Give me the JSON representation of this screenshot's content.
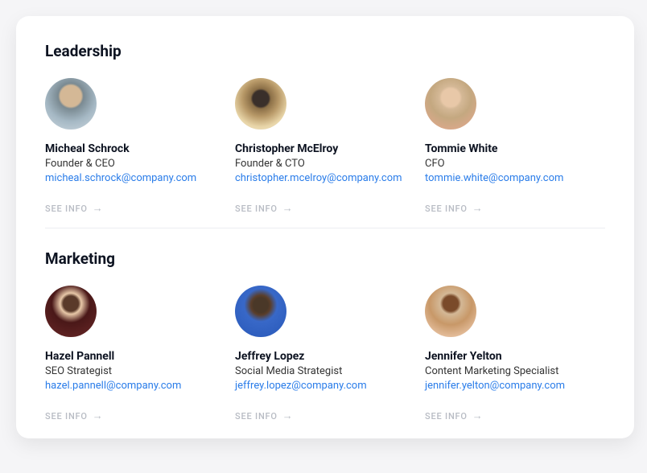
{
  "sections": [
    {
      "title": "Leadership",
      "people": [
        {
          "name": "Micheal Schrock",
          "role": "Founder & CEO",
          "email": "micheal.schrock@company.com",
          "see_info": "SEE INFO"
        },
        {
          "name": "Christopher McElroy",
          "role": "Founder & CTO",
          "email": "christopher.mcelroy@company.com",
          "see_info": "SEE INFO"
        },
        {
          "name": "Tommie White",
          "role": "CFO",
          "email": "tommie.white@company.com",
          "see_info": "SEE INFO"
        }
      ]
    },
    {
      "title": "Marketing",
      "people": [
        {
          "name": "Hazel Pannell",
          "role": "SEO Strategist",
          "email": "hazel.pannell@company.com",
          "see_info": "SEE INFO"
        },
        {
          "name": "Jeffrey Lopez",
          "role": "Social Media Strategist",
          "email": "jeffrey.lopez@company.com",
          "see_info": "SEE INFO"
        },
        {
          "name": "Jennifer Yelton",
          "role": "Content Marketing Specialist",
          "email": "jennifer.yelton@company.com",
          "see_info": "SEE INFO"
        }
      ]
    }
  ]
}
